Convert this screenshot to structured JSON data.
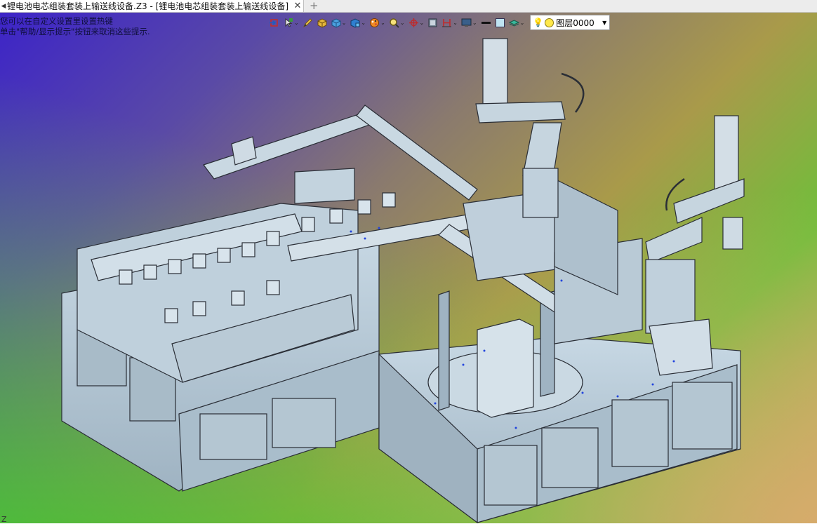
{
  "tab": {
    "title": "锂电池电芯组装套装上输送线设备.Z3 - [锂电池电芯组装套装上输送线设备]",
    "close_icon": "close-icon",
    "new_tab_icon": "plus-icon"
  },
  "hints": {
    "line1": "您可以在自定义设置里设置热键",
    "line2": "单击\"帮助/显示提示\"按钮来取消这些提示."
  },
  "toolbar": {
    "items": [
      {
        "name": "exit-icon"
      },
      {
        "name": "pick-filter-icon"
      },
      {
        "name": "pen-icon"
      },
      {
        "name": "shade-icon"
      },
      {
        "name": "view-cube-icon"
      },
      {
        "name": "display-mode-icon"
      },
      {
        "name": "render-style-icon"
      },
      {
        "name": "zoom-icon"
      },
      {
        "name": "rotate-icon"
      },
      {
        "name": "section-icon"
      },
      {
        "name": "constraint-icon"
      },
      {
        "name": "monitor-icon"
      },
      {
        "name": "line-color-icon"
      },
      {
        "name": "fill-color-icon"
      },
      {
        "name": "layer-material-icon"
      }
    ],
    "layer": {
      "label": "图层0000"
    }
  },
  "colors": {
    "machine_fill": "#b8cbd8",
    "machine_stroke": "#2a2e36",
    "bg_top_left": "#3b22c9",
    "bg_bottom_left": "#44d624",
    "bg_right": "#d8a968"
  },
  "footer": {
    "corner_text": "Z"
  }
}
